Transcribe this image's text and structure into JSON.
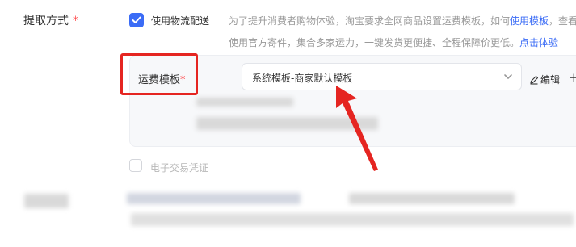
{
  "field": {
    "label": "提取方式",
    "required_mark": "*"
  },
  "logistics": {
    "checkbox_label": "使用物流配送",
    "checked": true,
    "desc_line1_prefix": "为了提升消费者购物体验，淘宝要求全网商品设置运费模板，如何",
    "desc_line1_link": "使用模板",
    "desc_line1_suffix": "，查看",
    "desc_line2_prefix": "使用官方寄件，集合多家运力，一键发货更便捷、全程保障价更低。",
    "desc_line2_link": "点击体验"
  },
  "freight_template": {
    "label": "运费模板",
    "required_mark": "*",
    "selected_value": "系统模板-商家默认模板",
    "edit_label": "编辑",
    "add_label": "+"
  },
  "e_voucher": {
    "checkbox_label": "电子交易凭证",
    "checked": false,
    "disabled": true
  },
  "colors": {
    "accent": "#3b6cf6",
    "annotation_red": "#e52521",
    "required": "#ff4d4f"
  },
  "icons": {
    "checkbox": "checkmark-icon",
    "select": "chevron-down-icon",
    "edit": "pencil-icon",
    "annotation": "red-arrow-annotation"
  }
}
